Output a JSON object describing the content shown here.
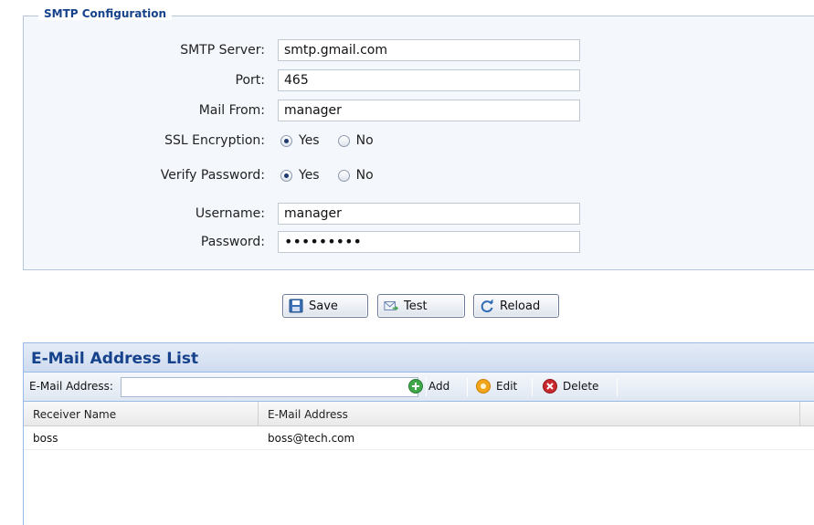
{
  "smtp": {
    "legend": "SMTP Configuration",
    "server_label": "SMTP Server:",
    "server_value": "smtp.gmail.com",
    "port_label": "Port:",
    "port_value": "465",
    "mail_from_label": "Mail From:",
    "mail_from_value": "manager",
    "ssl_label": "SSL Encryption:",
    "ssl_options": [
      "Yes",
      "No"
    ],
    "ssl_selected": "Yes",
    "verify_label": "Verify Password:",
    "verify_options": [
      "Yes",
      "No"
    ],
    "verify_selected": "Yes",
    "username_label": "Username:",
    "username_value": "manager",
    "password_label": "Password:",
    "password_value": "•••••••••"
  },
  "actions": {
    "save_label": "Save",
    "test_label": "Test",
    "reload_label": "Reload"
  },
  "email_list": {
    "title": "E-Mail Address List",
    "address_label": "E-Mail Address:",
    "address_value": "",
    "add_label": "Add",
    "edit_label": "Edit",
    "delete_label": "Delete",
    "columns": [
      "Receiver Name",
      "E-Mail Address"
    ],
    "rows": [
      {
        "name": "boss",
        "email": "boss@tech.com"
      }
    ]
  },
  "colors": {
    "accent": "#15428b",
    "panel_border": "#99bbe8",
    "add_icon": "#3fa64a",
    "edit_icon": "#f2a51a",
    "delete_icon": "#c8282e"
  }
}
